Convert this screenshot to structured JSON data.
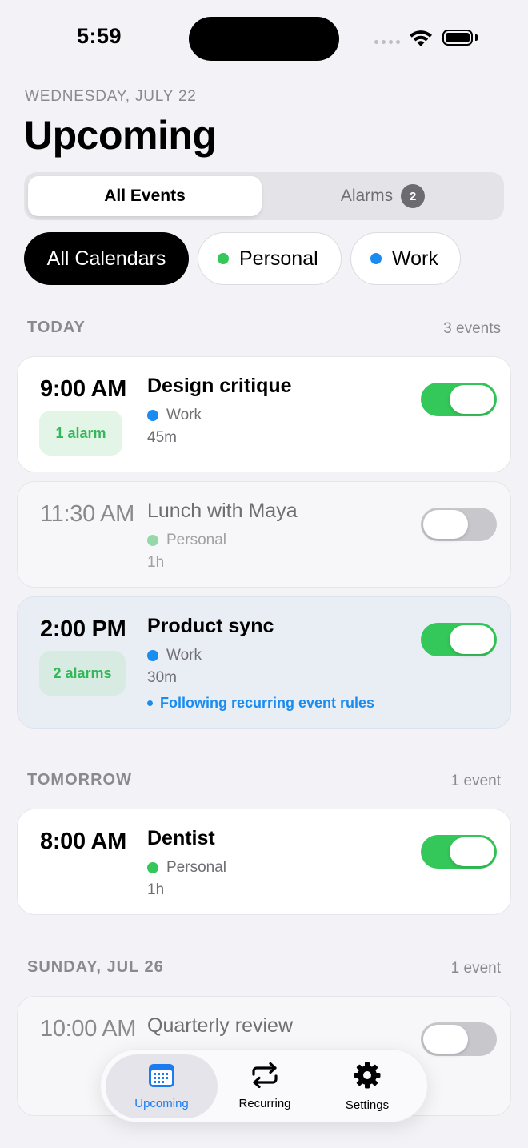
{
  "status_bar": {
    "time": "5:59"
  },
  "header": {
    "date": "WEDNESDAY, JULY 22",
    "title": "Upcoming"
  },
  "segmented": {
    "all_events": "All Events",
    "alarms": "Alarms",
    "alarms_badge": "2"
  },
  "filters": [
    {
      "label": "All Calendars",
      "selected": true
    },
    {
      "label": "Personal",
      "color": "#34c759"
    },
    {
      "label": "Work",
      "color": "#1a8cef"
    }
  ],
  "sections": [
    {
      "header": "TODAY",
      "count": "3 events",
      "events": [
        {
          "time": "9:00 AM",
          "title": "Design critique",
          "calendar": "Work",
          "calendar_color": "#1a8cef",
          "duration": "45m",
          "alarm": "1 alarm",
          "enabled": true
        },
        {
          "time": "11:30 AM",
          "title": "Lunch with Maya",
          "calendar": "Personal",
          "calendar_color": "#96d9a8",
          "duration": "1h",
          "enabled": false
        },
        {
          "time": "2:00 PM",
          "title": "Product sync",
          "calendar": "Work",
          "calendar_color": "#1a8cef",
          "duration": "30m",
          "alarm": "2 alarms",
          "note": "Following recurring event rules",
          "enabled": true
        }
      ]
    },
    {
      "header": "TOMORROW",
      "count": "1 event",
      "events": [
        {
          "time": "8:00 AM",
          "title": "Dentist",
          "calendar": "Personal",
          "calendar_color": "#34c759",
          "duration": "1h",
          "enabled": true
        }
      ]
    },
    {
      "header": "SUNDAY, JUL 26",
      "count": "1 event",
      "events": [
        {
          "time": "10:00 AM",
          "title": "Quarterly review",
          "enabled": false
        }
      ]
    }
  ],
  "tabbar": {
    "upcoming": "Upcoming",
    "recurring": "Recurring",
    "settings": "Settings",
    "active_color": "#1a7cf0"
  }
}
